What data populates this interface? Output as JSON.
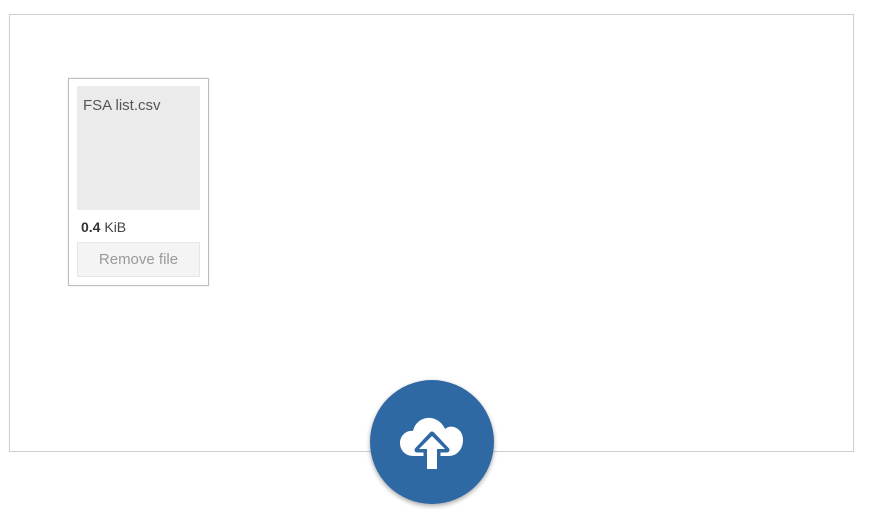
{
  "dropzone": {
    "files": [
      {
        "name": "FSA list.csv",
        "size_value": "0.4",
        "size_unit": "KiB",
        "remove_label": "Remove file"
      }
    ],
    "upload_icon": "cloud-upload-icon"
  },
  "colors": {
    "upload_button_bg": "#2f69a4",
    "thumb_bg": "#ebebeb",
    "border": "#cfcfcf"
  }
}
